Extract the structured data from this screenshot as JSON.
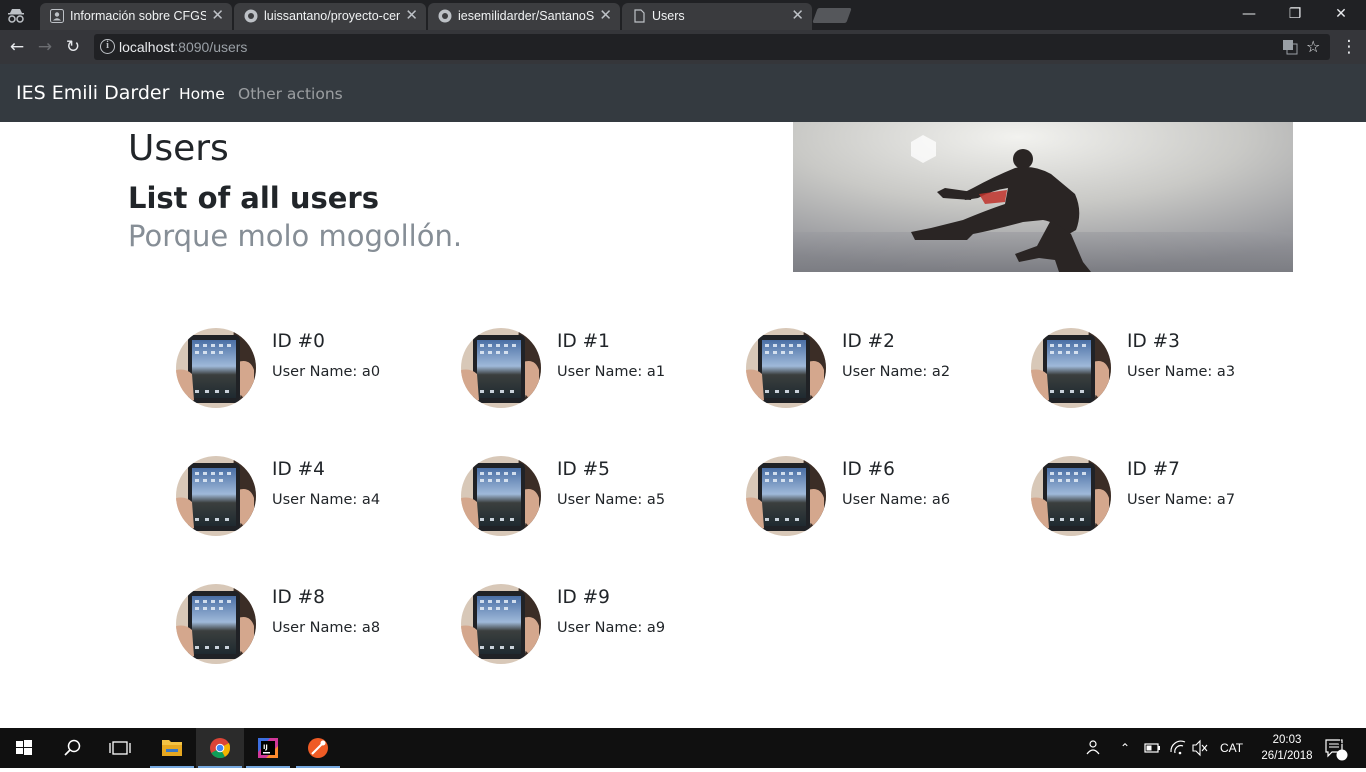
{
  "browser": {
    "tabs": [
      {
        "title": "Información sobre CFGS",
        "icon": "person-card-icon"
      },
      {
        "title": "luissantano/proyecto-cen",
        "icon": "github-icon"
      },
      {
        "title": "iesemilidarder/SantanoS",
        "icon": "github-icon"
      },
      {
        "title": "Users",
        "icon": "page-icon",
        "active": true
      }
    ],
    "url_host": "localhost",
    "url_rest": ":8090/users"
  },
  "nav": {
    "brand": "IES Emili Darder",
    "home": "Home",
    "other": "Other actions"
  },
  "header": {
    "title": "Users",
    "subtitle": "List of all users",
    "lead": "Porque molo mogollón."
  },
  "users": [
    {
      "id": "ID #0",
      "name": "User Name: a0"
    },
    {
      "id": "ID #1",
      "name": "User Name: a1"
    },
    {
      "id": "ID #2",
      "name": "User Name: a2"
    },
    {
      "id": "ID #3",
      "name": "User Name: a3"
    },
    {
      "id": "ID #4",
      "name": "User Name: a4"
    },
    {
      "id": "ID #5",
      "name": "User Name: a5"
    },
    {
      "id": "ID #6",
      "name": "User Name: a6"
    },
    {
      "id": "ID #7",
      "name": "User Name: a7"
    },
    {
      "id": "ID #8",
      "name": "User Name: a8"
    },
    {
      "id": "ID #9",
      "name": "User Name: a9"
    }
  ],
  "taskbar": {
    "language": "CAT",
    "time": "20:03",
    "date": "26/1/2018",
    "notifications": "1"
  }
}
